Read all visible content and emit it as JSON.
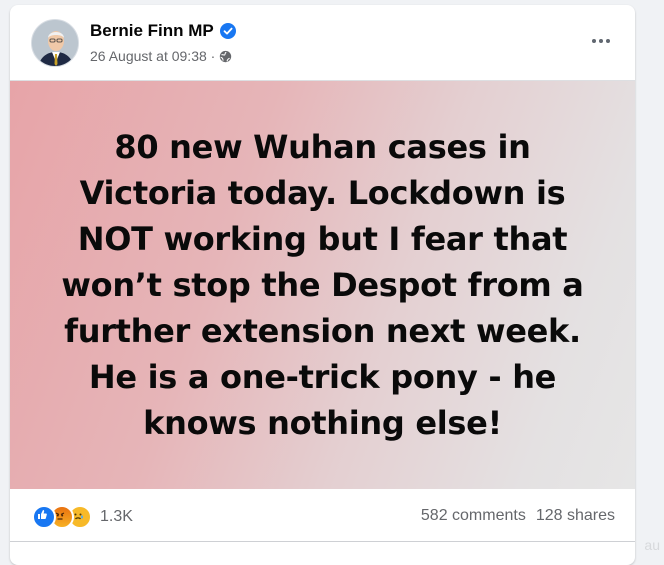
{
  "post": {
    "author": "Bernie Finn MP",
    "timestamp": "26 August at 09:38 ·",
    "verified_icon": "verified-badge-icon",
    "privacy_icon": "globe-icon",
    "image_text": "80 new Wuhan cases in Victoria today. Lockdown is NOT working but I fear that won’t stop the Despot from a further extension next week. He is a one-trick pony - he knows nothing else!"
  },
  "footer": {
    "reaction_icons": [
      "like-icon",
      "angry-icon",
      "sad-icon"
    ],
    "reaction_count": "1.3K",
    "comments": "582 comments",
    "shares": "128 shares"
  },
  "watermark": "au",
  "colors": {
    "accent": "#1877f2",
    "secondary_text": "#65676b",
    "image_gradient_left": "#e7a4a8",
    "image_gradient_right": "#e6e6e6"
  }
}
